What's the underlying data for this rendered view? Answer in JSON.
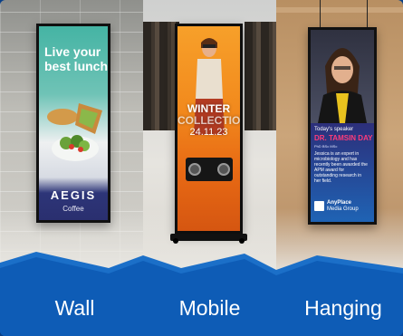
{
  "categories": [
    {
      "label": "Wall"
    },
    {
      "label": "Mobile"
    },
    {
      "label": "Hanging"
    }
  ],
  "wall_screen": {
    "headline": "Live your best lunch",
    "brand": "AEGIS",
    "sub": "Coffee"
  },
  "mobile_screen": {
    "line1": "WINTER",
    "line2": "COLLECTION",
    "date": "24.11.23"
  },
  "hanging_screen": {
    "label": "Today's speaker",
    "name": "DR. TAMSIN DAY",
    "role": "PhD BSc MSc",
    "bio": "Jessica is an expert in microbiology and has recently been awarded the APM award for outstanding research in her field.",
    "brand_line1": "AnyPlace",
    "brand_line2": "Media Group"
  },
  "colors": {
    "background": "#0b4e9f",
    "accent": "#1a8fe0",
    "text": "#ffffff"
  }
}
